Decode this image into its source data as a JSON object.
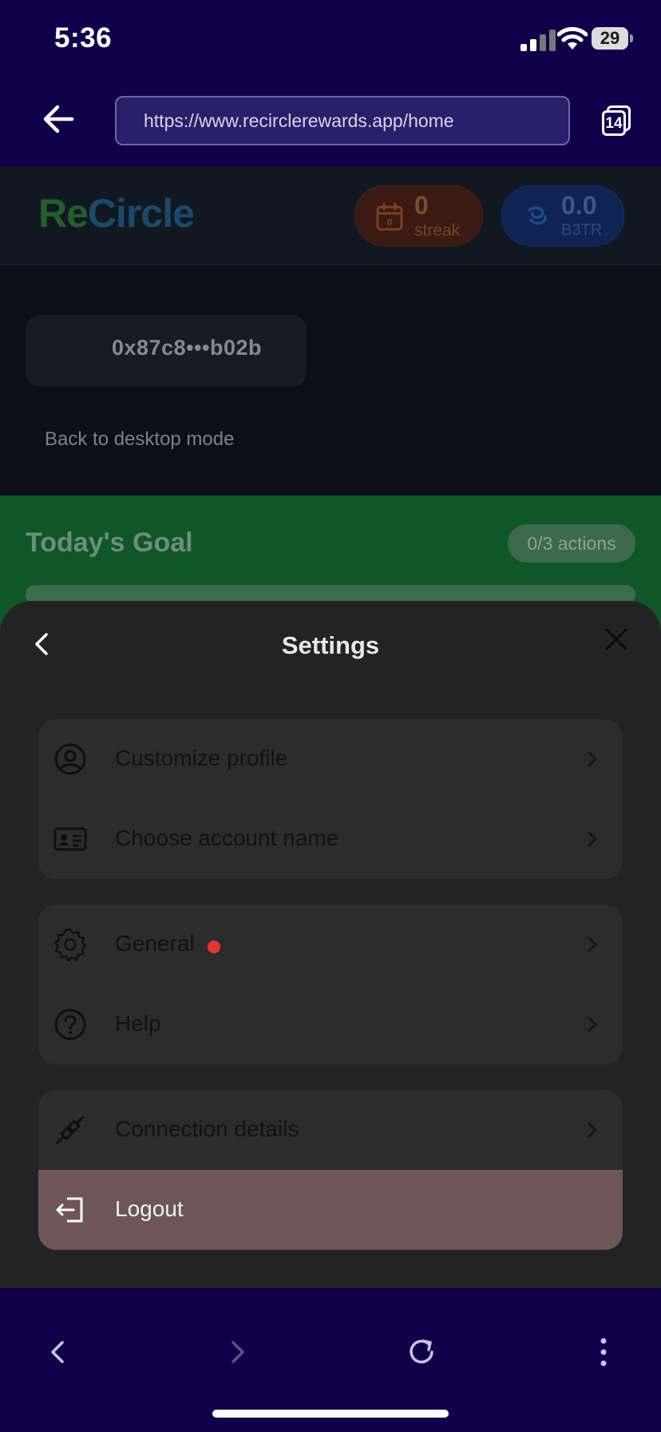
{
  "status_bar": {
    "time": "5:36",
    "battery": "29"
  },
  "browser": {
    "url": "https://www.recirclerewards.app/home",
    "tab_count": "14"
  },
  "app": {
    "logo_part1": "Re",
    "logo_part2": "Circle",
    "streak": {
      "value": "0",
      "label": "streak"
    },
    "b3tr": {
      "value": "0.0",
      "label": "B3TR"
    },
    "address": "0x87c8•••b02b",
    "desktop_link": "Back to desktop mode",
    "goal": {
      "title": "Today's Goal",
      "badge": "0/3 actions",
      "progress": 0
    }
  },
  "settings": {
    "title": "Settings",
    "group1": [
      "Customize profile",
      "Choose account name"
    ],
    "group2": [
      "General",
      "Help"
    ],
    "group3": [
      "Connection details",
      "Logout"
    ]
  },
  "colors": {
    "browser_chrome": "#11004a",
    "sheet_bg": "#232323",
    "logout_bg": "#6e5556",
    "notification_dot": "#e53535"
  }
}
